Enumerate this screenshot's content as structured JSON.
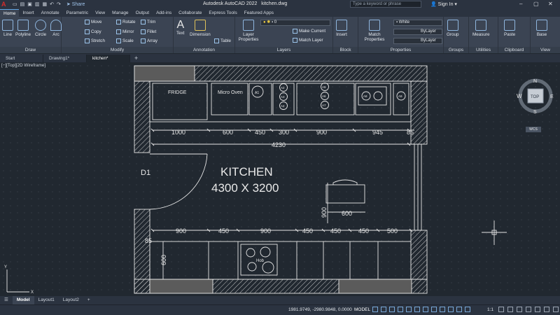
{
  "title_bar": {
    "app_title": "Autodesk AutoCAD 2022",
    "file_name": "kitchen.dwg",
    "search_placeholder": "Type a keyword or phrase",
    "share_label": "Share",
    "signin_label": "Sign In",
    "logo_letter": "A"
  },
  "ribbon_tabs": [
    "Home",
    "Insert",
    "Annotate",
    "Parametric",
    "View",
    "Manage",
    "Output",
    "Add-ins",
    "Collaborate",
    "Express Tools",
    "Featured Apps"
  ],
  "ribbon": {
    "draw": {
      "title": "Draw",
      "line": "Line",
      "polyline": "Polyline",
      "circle": "Circle",
      "arc": "Arc"
    },
    "modify": {
      "title": "Modify",
      "move": "Move",
      "rotate": "Rotate",
      "trim": "Trim",
      "copy": "Copy",
      "mirror": "Mirror",
      "fillet": "Fillet",
      "stretch": "Stretch",
      "scale": "Scale",
      "array": "Array"
    },
    "annotation": {
      "title": "Annotation",
      "text": "Text",
      "dimension": "Dimension",
      "table": "Table"
    },
    "layers": {
      "title": "Layers",
      "layer_properties_line1": "Layer",
      "layer_properties_line2": "Properties",
      "current_layer": "0",
      "make_current": "Make Current",
      "match_layer": "Match Layer"
    },
    "block": {
      "title": "Block",
      "insert": "Insert"
    },
    "properties": {
      "title": "Properties",
      "match_line1": "Match",
      "match_line2": "Properties",
      "color": "White",
      "linetype": "ByLayer",
      "lineweight": "ByLayer"
    },
    "groups": {
      "title": "Groups",
      "group": "Group"
    },
    "utilities": {
      "title": "Utilities",
      "measure": "Measure"
    },
    "clipboard": {
      "title": "Clipboard",
      "paste": "Paste"
    },
    "view": {
      "title": "View",
      "base": "Base"
    }
  },
  "file_tabs": [
    {
      "label": "Start"
    },
    {
      "label": "Drawing1*"
    },
    {
      "label": "kitchen*"
    }
  ],
  "viewport_label": "[−][Top][2D Wireframe]",
  "drawing": {
    "room_title": "KITCHEN",
    "room_size": "4300 X 3200",
    "door_label": "D1",
    "fridge_label": "FRIDGE",
    "micro_oven_label": "Micro Oven",
    "hob_label": "Hob",
    "appliance_circles": [
      "A1",
      "A2",
      "A3",
      "A4",
      "A5",
      "A6",
      "A7",
      "A8",
      "A9"
    ],
    "top_dims": [
      "1000",
      "600",
      "450",
      "300",
      "900",
      "945",
      "85"
    ],
    "overall_dim": "4230",
    "bottom_dims": [
      "900",
      "450",
      "900",
      "450",
      "450",
      "450",
      "500"
    ],
    "left_dim_85": "85",
    "left_dim_600": "600",
    "island_dims": [
      "900",
      "600"
    ]
  },
  "view_cube": {
    "top": "TOP",
    "north": "N",
    "south": "S",
    "east": "E",
    "west": "W",
    "wcs": "WCS"
  },
  "layout_tabs": [
    "Model",
    "Layout1",
    "Layout2"
  ],
  "status_bar": {
    "coordinates": "1981.9749, -2980.9848, 0.0000",
    "space": "MODEL",
    "scale": "1:1"
  },
  "colors": {
    "background": "#212830",
    "ribbon": "#3b4453",
    "accent": "#62a8e5",
    "line": "#e6e6e6"
  }
}
